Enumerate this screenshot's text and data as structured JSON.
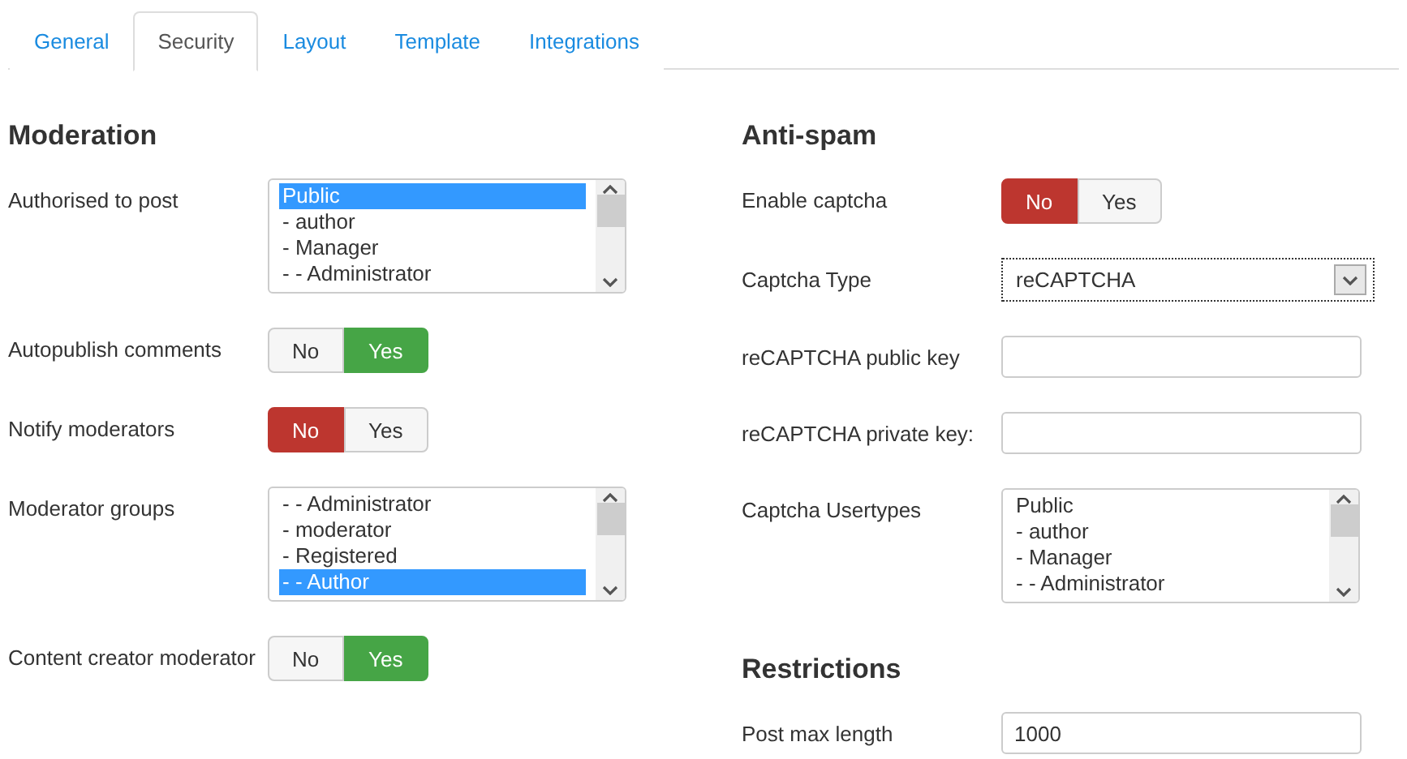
{
  "tabs": [
    {
      "label": "General",
      "selected": false
    },
    {
      "label": "Security",
      "selected": true
    },
    {
      "label": "Layout",
      "selected": false
    },
    {
      "label": "Template",
      "selected": false
    },
    {
      "label": "Integrations",
      "selected": false
    }
  ],
  "columns": [
    {
      "heading": "Moderation",
      "fields": [
        {
          "kind": "listbox",
          "label": "Authorised to post",
          "items": [
            {
              "label": "Public",
              "selected": true
            },
            {
              "label": "- author",
              "selected": false
            },
            {
              "label": "- Manager",
              "selected": false
            },
            {
              "label": "- - Administrator",
              "selected": false
            }
          ]
        },
        {
          "kind": "toggle",
          "label": "Autopublish comments",
          "options": [
            {
              "label": "No",
              "kind": "negative",
              "selected": false
            },
            {
              "label": "Yes",
              "kind": "positive",
              "selected": true
            }
          ]
        },
        {
          "kind": "toggle",
          "label": "Notify moderators",
          "options": [
            {
              "label": "No",
              "kind": "negative",
              "selected": true
            },
            {
              "label": "Yes",
              "kind": "positive",
              "selected": false
            }
          ]
        },
        {
          "kind": "listbox",
          "label": "Moderator groups",
          "items": [
            {
              "label": "- - Administrator",
              "selected": false
            },
            {
              "label": "- moderator",
              "selected": false
            },
            {
              "label": "- Registered",
              "selected": false
            },
            {
              "label": "- - Author",
              "selected": true
            }
          ]
        },
        {
          "kind": "toggle",
          "label": "Content creator moderator",
          "options": [
            {
              "label": "No",
              "kind": "negative",
              "selected": false
            },
            {
              "label": "Yes",
              "kind": "positive",
              "selected": true
            }
          ]
        }
      ]
    },
    {
      "heading": "Anti-spam",
      "fields": [
        {
          "kind": "toggle",
          "label": "Enable captcha",
          "options": [
            {
              "label": "No",
              "kind": "negative",
              "selected": true
            },
            {
              "label": "Yes",
              "kind": "positive",
              "selected": false
            }
          ]
        },
        {
          "kind": "select",
          "label": "Captcha Type",
          "value": "reCAPTCHA"
        },
        {
          "kind": "text",
          "label": "reCAPTCHA public key"
        },
        {
          "kind": "text",
          "label": "reCAPTCHA private key:"
        },
        {
          "kind": "listbox",
          "label": "Captcha Usertypes",
          "items": [
            {
              "label": "Public",
              "selected": false
            },
            {
              "label": "- author",
              "selected": false
            },
            {
              "label": "- Manager",
              "selected": false
            },
            {
              "label": "- - Administrator",
              "selected": false
            }
          ]
        }
      ],
      "subheading": "Restrictions",
      "subfields": [
        {
          "kind": "text",
          "label": "Post max length",
          "value": "1000"
        }
      ]
    }
  ]
}
